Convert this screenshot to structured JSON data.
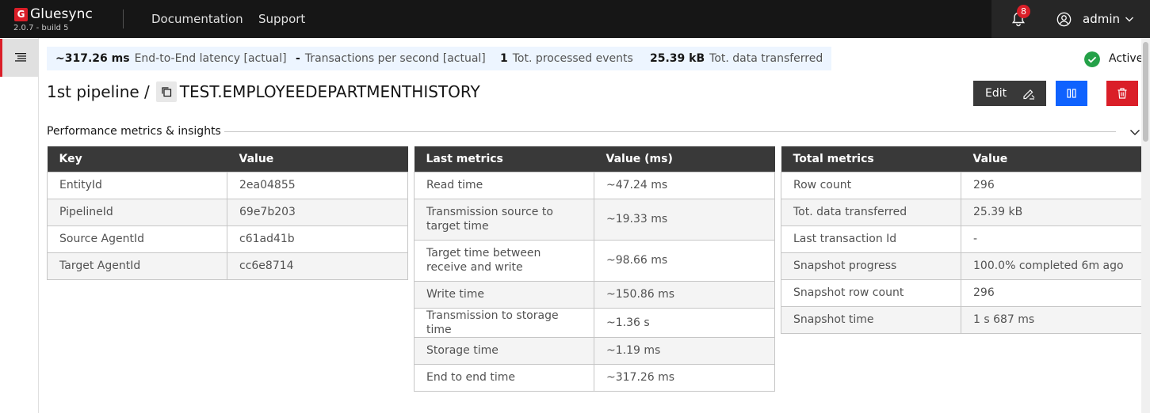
{
  "header": {
    "brand": "Gluesync",
    "brand_letter": "G",
    "version": "2.0.7 - build 5",
    "nav": [
      "Documentation",
      "Support"
    ],
    "notifications_count": "8",
    "user": "admin"
  },
  "stats": [
    {
      "value": "~317.26 ms",
      "label": "End-to-End latency [actual]"
    },
    {
      "value": "-",
      "label": "Transactions per second [actual]"
    },
    {
      "value": "1",
      "label": "Tot. processed events"
    },
    {
      "value": "25.39 kB",
      "label": "Tot. data transferred"
    }
  ],
  "status": "Active",
  "title": {
    "pipeline": "1st pipeline /",
    "entity": "TEST.EMPLOYEEDEPARTMENTHISTORY"
  },
  "actions": {
    "edit": "Edit"
  },
  "section": {
    "title": "Performance metrics & insights"
  },
  "tables": {
    "ids": {
      "headers": [
        "Key",
        "Value"
      ],
      "rows": [
        [
          "EntityId",
          "2ea04855"
        ],
        [
          "PipelineId",
          "69e7b203"
        ],
        [
          "Source AgentId",
          "c61ad41b"
        ],
        [
          "Target AgentId",
          "cc6e8714"
        ]
      ]
    },
    "last": {
      "headers": [
        "Last metrics",
        "Value (ms)"
      ],
      "rows": [
        [
          "Read time",
          "~47.24 ms"
        ],
        [
          "Transmission source to target time",
          "~19.33 ms"
        ],
        [
          "Target time between receive and write",
          "~98.66 ms"
        ],
        [
          "Write time",
          "~150.86 ms"
        ],
        [
          "Transmission to storage time",
          "~1.36 s"
        ],
        [
          "Storage time",
          "~1.19 ms"
        ],
        [
          "End to end time",
          "~317.26 ms"
        ]
      ]
    },
    "total": {
      "headers": [
        "Total metrics",
        "Value"
      ],
      "rows": [
        [
          "Row count",
          "296"
        ],
        [
          "Tot. data transferred",
          "25.39 kB"
        ],
        [
          "Last transaction Id",
          "-"
        ],
        [
          "Snapshot progress",
          "100.0% completed 6m ago"
        ],
        [
          "Snapshot row count",
          "296"
        ],
        [
          "Snapshot time",
          "1 s 687 ms"
        ]
      ]
    }
  },
  "colors": {
    "accent_red": "#da1e28",
    "primary_blue": "#0f62fe",
    "success_green": "#24a148",
    "header_bg": "#161616"
  }
}
